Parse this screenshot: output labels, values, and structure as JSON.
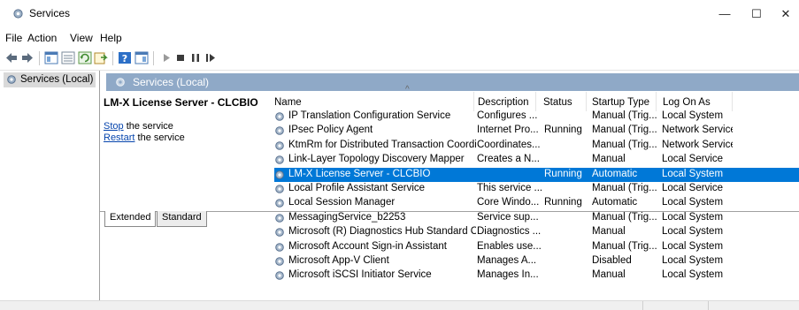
{
  "window": {
    "title": "Services",
    "minimize": "—",
    "maximize": "☐",
    "close": "✕"
  },
  "menu": [
    "File",
    "Action",
    "View",
    "Help"
  ],
  "toolbar_icons": [
    "back-arrow-icon",
    "forward-arrow-icon",
    "show-hide-tree-icon",
    "console-icon",
    "refresh-icon",
    "export-list-icon",
    "help-icon",
    "properties-icon",
    "start-service-icon",
    "stop-service-icon",
    "pause-service-icon",
    "resume-service-icon"
  ],
  "tree": {
    "selected": "Services (Local)"
  },
  "pane_header": "Services (Local)",
  "details": {
    "service_name": "LM-X License Server - CLCBIO",
    "stop_link": "Stop",
    "stop_rest": " the service",
    "restart_link": "Restart",
    "restart_rest": " the service"
  },
  "columns": [
    "Name",
    "Description",
    "Status",
    "Startup Type",
    "Log On As"
  ],
  "services": [
    {
      "name": "IP Translation Configuration Service",
      "description": "Configures ...",
      "status": "",
      "startup": "Manual (Trig...",
      "logon": "Local System"
    },
    {
      "name": "IPsec Policy Agent",
      "description": "Internet Pro...",
      "status": "Running",
      "startup": "Manual (Trig...",
      "logon": "Network Service"
    },
    {
      "name": "KtmRm for Distributed Transaction Coordin...",
      "description": "Coordinates...",
      "status": "",
      "startup": "Manual (Trig...",
      "logon": "Network Service"
    },
    {
      "name": "Link-Layer Topology Discovery Mapper",
      "description": "Creates a N...",
      "status": "",
      "startup": "Manual",
      "logon": "Local Service"
    },
    {
      "name": "LM-X License Server - CLCBIO",
      "description": "",
      "status": "Running",
      "startup": "Automatic",
      "logon": "Local System",
      "selected": true
    },
    {
      "name": "Local Profile Assistant Service",
      "description": "This service ...",
      "status": "",
      "startup": "Manual (Trig...",
      "logon": "Local Service"
    },
    {
      "name": "Local Session Manager",
      "description": "Core Windo...",
      "status": "Running",
      "startup": "Automatic",
      "logon": "Local System"
    },
    {
      "name": "MessagingService_b2253",
      "description": "Service sup...",
      "status": "",
      "startup": "Manual (Trig...",
      "logon": "Local System"
    },
    {
      "name": "Microsoft (R) Diagnostics Hub Standard Coll...",
      "description": "Diagnostics ...",
      "status": "",
      "startup": "Manual",
      "logon": "Local System"
    },
    {
      "name": "Microsoft Account Sign-in Assistant",
      "description": "Enables use...",
      "status": "",
      "startup": "Manual (Trig...",
      "logon": "Local System"
    },
    {
      "name": "Microsoft App-V Client",
      "description": "Manages A...",
      "status": "",
      "startup": "Disabled",
      "logon": "Local System"
    },
    {
      "name": "Microsoft iSCSI Initiator Service",
      "description": "Manages In...",
      "status": "",
      "startup": "Manual",
      "logon": "Local System"
    }
  ],
  "tabs": [
    "Extended",
    "Standard"
  ],
  "colors": {
    "selection": "#0078d7",
    "header_band": "#8fa9c7",
    "link": "#0645ad"
  }
}
